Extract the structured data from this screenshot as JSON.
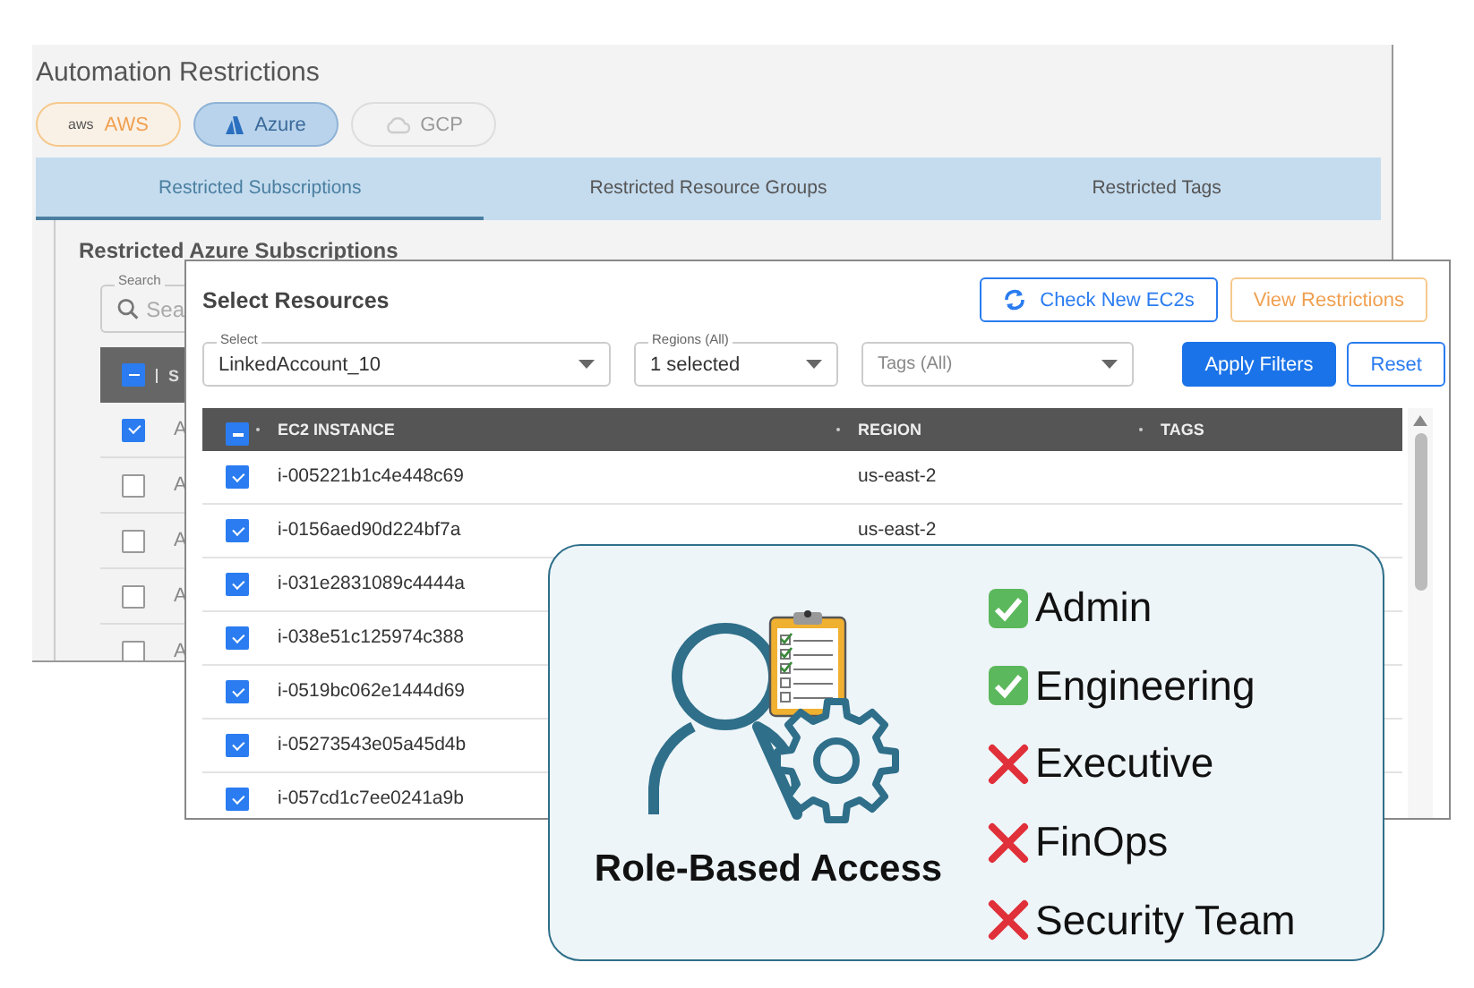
{
  "back_window": {
    "title": "Automation Restrictions",
    "providers": [
      {
        "label": "AWS",
        "badge": "aws",
        "kind": "aws",
        "selected": false,
        "disabled": false
      },
      {
        "label": "Azure",
        "kind": "azure",
        "selected": true,
        "disabled": false
      },
      {
        "label": "GCP",
        "kind": "gcp",
        "selected": false,
        "disabled": true
      }
    ],
    "tabs": [
      {
        "label": "Restricted Subscriptions",
        "selected": true
      },
      {
        "label": "Restricted Resource Groups",
        "selected": false
      },
      {
        "label": "Restricted Tags",
        "selected": false
      }
    ],
    "section_title": "Restricted Azure Subscriptions",
    "search": {
      "label": "Search",
      "placeholder": "Sea"
    },
    "table": {
      "select_all_partial": true,
      "columns": [
        "S"
      ],
      "rows": [
        {
          "cell": "A",
          "checked": true
        },
        {
          "cell": "A",
          "checked": false
        },
        {
          "cell": "A",
          "checked": false
        },
        {
          "cell": "A",
          "checked": false
        },
        {
          "cell": "A",
          "checked": false
        }
      ]
    }
  },
  "front_window": {
    "title": "Select Resources",
    "buttons": [
      {
        "label": "Check New EC2s",
        "kind": "refresh"
      },
      {
        "label": "View Restrictions",
        "kind": "warning"
      }
    ],
    "filters": [
      {
        "label": "Select",
        "value": "LinkedAccount_10"
      },
      {
        "label": "Regions (All)",
        "value": "1 selected"
      },
      {
        "placeholder": "Tags (All)"
      }
    ],
    "actions": [
      {
        "label": "Apply Filters",
        "kind": "primary"
      },
      {
        "label": "Reset",
        "kind": "outline"
      }
    ],
    "table": {
      "select_all_partial": true,
      "columns": [
        "EC2 INSTANCE",
        "REGION",
        "TAGS"
      ],
      "rows": [
        {
          "instance": "i-005221b1c4e448c69",
          "region": "us-east-2",
          "checked": true
        },
        {
          "instance": "i-0156aed90d224bf7a",
          "region": "us-east-2",
          "checked": true
        },
        {
          "instance": "i-031e2831089c4444a",
          "checked": true
        },
        {
          "instance": "i-038e51c125974c388",
          "checked": true
        },
        {
          "instance": "i-0519bc062e1444d69",
          "checked": true
        },
        {
          "instance": "i-05273543e05a45d4b",
          "checked": true
        },
        {
          "instance": "i-057cd1c7ee0241a9b",
          "checked": true
        }
      ]
    }
  },
  "callout": {
    "title": "Role-Based Access",
    "roles": [
      {
        "name": "Admin",
        "allowed": true
      },
      {
        "name": "Engineering",
        "allowed": true
      },
      {
        "name": "Executive",
        "allowed": false
      },
      {
        "name": "FinOps",
        "allowed": false
      },
      {
        "name": "Security Team",
        "allowed": false
      }
    ]
  }
}
